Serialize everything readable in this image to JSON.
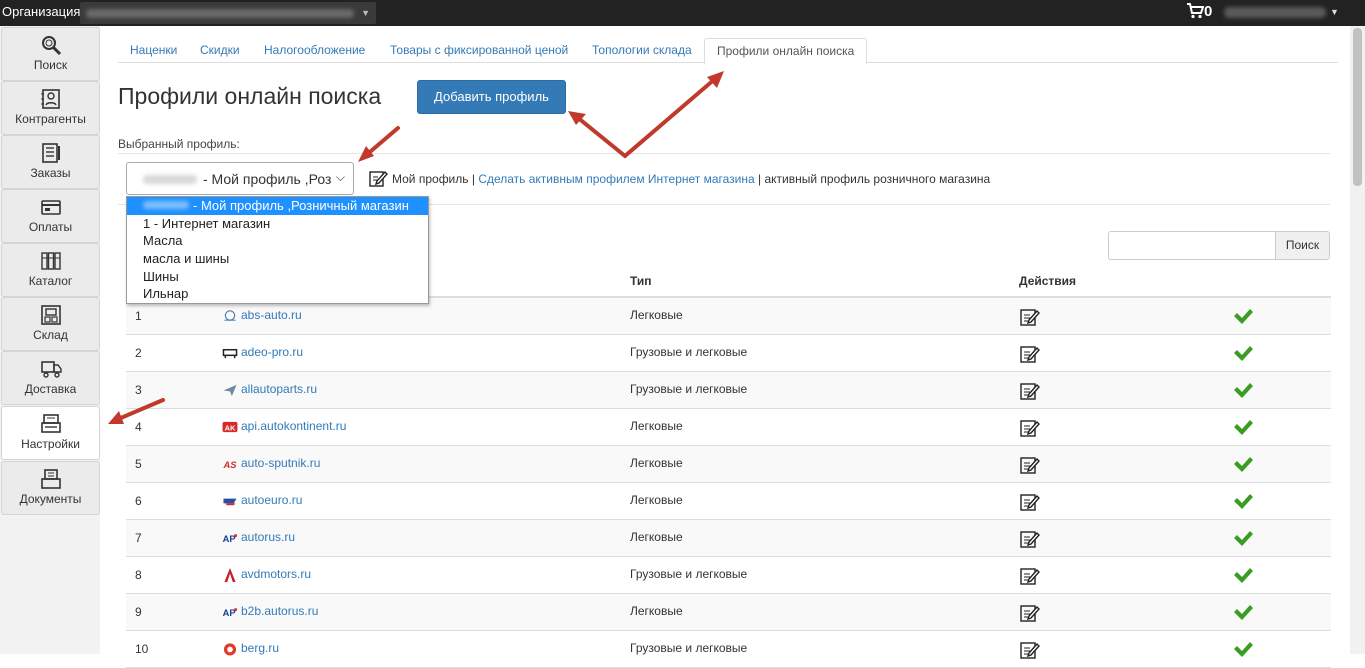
{
  "topbar": {
    "org_label": "Организация:",
    "cart_count": "0"
  },
  "sidebar": {
    "items": [
      {
        "label": "Поиск",
        "icon": "search-icon"
      },
      {
        "label": "Контрагенты",
        "icon": "contacts-icon"
      },
      {
        "label": "Заказы",
        "icon": "orders-icon"
      },
      {
        "label": "Оплаты",
        "icon": "payments-icon"
      },
      {
        "label": "Каталог",
        "icon": "catalog-icon"
      },
      {
        "label": "Склад",
        "icon": "warehouse-icon"
      },
      {
        "label": "Доставка",
        "icon": "delivery-icon"
      },
      {
        "label": "Настройки",
        "icon": "settings-icon"
      },
      {
        "label": "Документы",
        "icon": "documents-icon"
      }
    ],
    "active": "Настройки"
  },
  "tabs": [
    {
      "label": "Наценки"
    },
    {
      "label": "Скидки"
    },
    {
      "label": "Налогообложение"
    },
    {
      "label": "Товары с фиксированной ценой"
    },
    {
      "label": "Топологии склада"
    },
    {
      "label": "Профили онлайн поиска"
    }
  ],
  "active_tab": "Профили онлайн поиска",
  "page": {
    "title": "Профили онлайн поиска",
    "add_button": "Добавить профиль",
    "selected_label": "Выбранный профиль:",
    "select_value": "- Мой профиль ,Роз",
    "info": {
      "my_profile": "Мой профиль |",
      "make_active_link": "Сделать активным профилем Интернет магазина",
      "retail_text": "| активный профиль розничного магазина"
    },
    "dropdown_options": [
      "- Мой профиль ,Розничный магазин",
      "1 - Интернет магазин",
      "Масла",
      "масла и шины",
      "Шины",
      "Ильнар"
    ],
    "search_button": "Поиск",
    "search_placeholder": ""
  },
  "table": {
    "headers": {
      "type": "Тип",
      "actions": "Действия"
    },
    "rows": [
      {
        "num": "1",
        "site": "abs-auto.ru",
        "type": "Легковые",
        "logo": "abs-logo-icon"
      },
      {
        "num": "2",
        "site": "adeo-pro.ru",
        "type": "Грузовые и легковые",
        "logo": "adeo-logo-icon"
      },
      {
        "num": "3",
        "site": "allautoparts.ru",
        "type": "Грузовые и легковые",
        "logo": "plane-logo-icon"
      },
      {
        "num": "4",
        "site": "api.autokontinent.ru",
        "type": "Легковые",
        "logo": "ak-logo-icon"
      },
      {
        "num": "5",
        "site": "auto-sputnik.ru",
        "type": "Легковые",
        "logo": "as-logo-icon"
      },
      {
        "num": "6",
        "site": "autoeuro.ru",
        "type": "Легковые",
        "logo": "autoeuro-logo-icon"
      },
      {
        "num": "7",
        "site": "autorus.ru",
        "type": "Легковые",
        "logo": "ap-logo-icon"
      },
      {
        "num": "8",
        "site": "avdmotors.ru",
        "type": "Грузовые и легковые",
        "logo": "avd-logo-icon"
      },
      {
        "num": "9",
        "site": "b2b.autorus.ru",
        "type": "Легковые",
        "logo": "ap-logo-icon"
      },
      {
        "num": "10",
        "site": "berg.ru",
        "type": "Грузовые и легковые",
        "logo": "berg-logo-icon"
      }
    ]
  },
  "colors": {
    "accent": "#337ab7",
    "topbar": "#222222",
    "check": "#3a9d23",
    "annotation_arrow": "#c0392b",
    "dropdown_highlight": "#1e90ff"
  }
}
